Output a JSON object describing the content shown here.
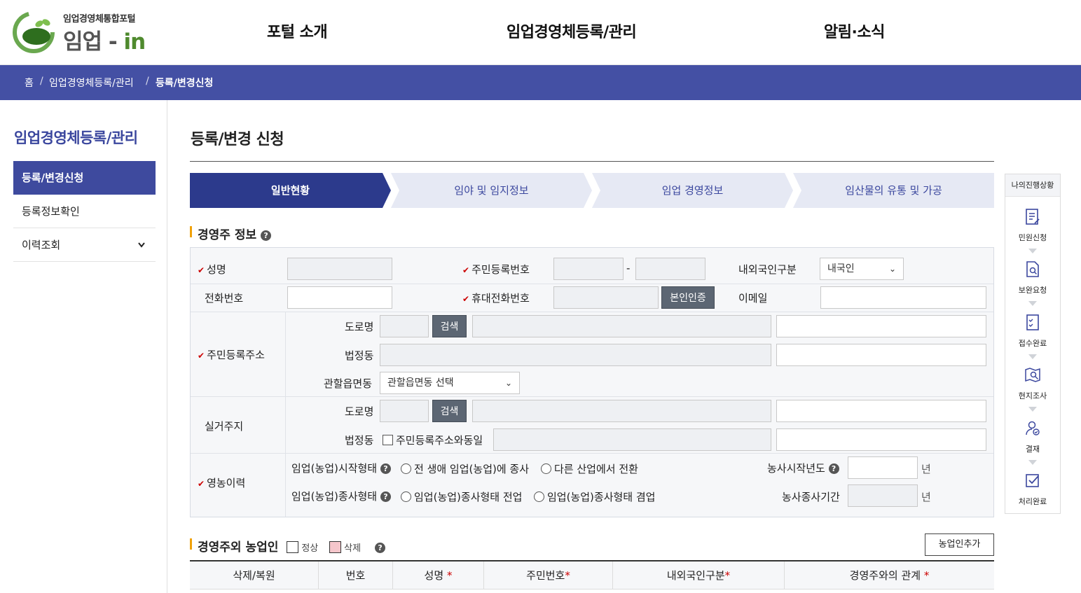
{
  "header": {
    "logo_sub": "임업경영체통합포털",
    "logo_main": "임업",
    "logo_dash": " - ",
    "logo_in": "in",
    "nav": [
      "포털 소개",
      "임업경영체등록/관리",
      "알림·소식"
    ]
  },
  "breadcrumb": {
    "home": "홈",
    "sep": "/",
    "level1": "임업경영체등록/관리",
    "current": "등록/변경신청"
  },
  "sidebar": {
    "title": "임업경영체등록/관리",
    "items": [
      {
        "label": "등록/변경신청"
      },
      {
        "label": "등록정보확인"
      },
      {
        "label": "이력조회"
      }
    ],
    "expand_icon": "chevron-down-icon"
  },
  "page": {
    "title": "등록/변경 신청"
  },
  "steps": [
    "일반현황",
    "임야 및 임지정보",
    "임업 경영정보",
    "임산물의 유통 및 가공"
  ],
  "owner_section": {
    "title": "경영주 정보",
    "req_mark": "✔",
    "name_label": "성명",
    "rrn_label": "주민등록번호",
    "rrn_dash": "-",
    "nationality_label": "내외국인구분",
    "nationality_value": "내국인",
    "phone_label": "전화번호",
    "mobile_label": "휴대전화번호",
    "verify_button": "본인인증",
    "email_label": "이메일",
    "resident_address_label": "주민등록주소",
    "road_label": "도로명",
    "search_button": "검색",
    "legal_dong_label": "법정동",
    "jurisdiction_label": "관할읍면동",
    "jurisdiction_placeholder": "관할읍면동 선택",
    "actual_address_label": "실거주지",
    "same_as_resident": "주민등록주소와동일",
    "farming_history_label": "영농이력",
    "start_type_label": "임업(농업)시작형태",
    "start_opt1": "전 생애 임업(농업)에 종사",
    "start_opt2": "다른 산업에서 전환",
    "start_year_label": "농사시작년도",
    "year_unit": "년",
    "work_type_label": "임업(농업)종사형태",
    "work_opt1": "임업(농업)종사형태 전업",
    "work_opt2": "임업(농업)종사형태 겸업",
    "work_period_label": "농사종사기간"
  },
  "side_panel": {
    "title": "나의진행상황",
    "steps": [
      {
        "label": "민원신청",
        "icon": "document-edit-icon"
      },
      {
        "label": "보완요청",
        "icon": "document-search-icon"
      },
      {
        "label": "접수완료",
        "icon": "checklist-icon"
      },
      {
        "label": "현지조사",
        "icon": "map-search-icon"
      },
      {
        "label": "결재",
        "icon": "user-check-icon"
      },
      {
        "label": "처리완료",
        "icon": "checkbox-icon"
      }
    ]
  },
  "farmers_section": {
    "title": "경영주외 농업인",
    "legend_normal": "정상",
    "legend_delete": "삭제",
    "add_button": "농업인추가",
    "columns": [
      "삭제/복원",
      "번호",
      "성명",
      "주민번호",
      "내외국인구분",
      "경영주와의 관계"
    ],
    "required_star": "*"
  },
  "colors": {
    "accent": "#4450a4",
    "active_step": "#2c3a8c",
    "step_bg": "#e6e9f4",
    "section_bar": "#f0a20a"
  }
}
